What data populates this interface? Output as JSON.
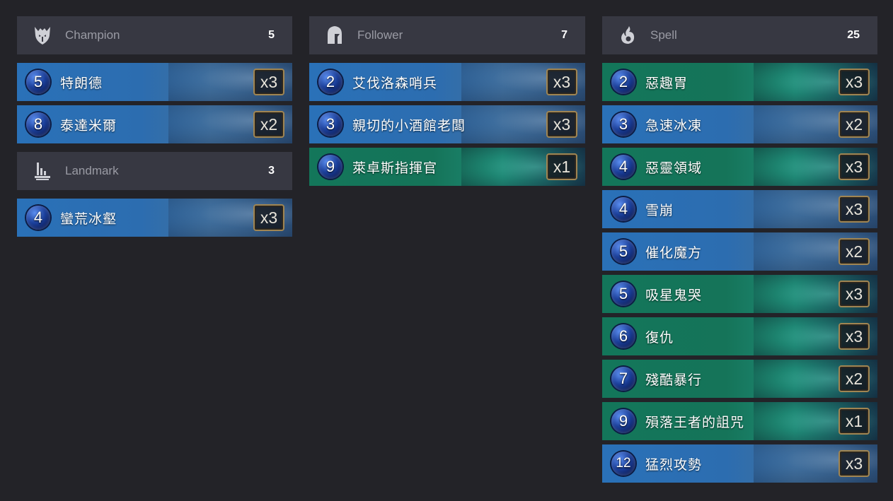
{
  "groups": [
    {
      "label": "Champion",
      "count": "5",
      "icon": "champion-helmet-icon",
      "cards": [
        {
          "cost": "5",
          "name": "特朗德",
          "copies": "x3",
          "color": "blue"
        },
        {
          "cost": "8",
          "name": "泰達米爾",
          "copies": "x2",
          "color": "blue"
        }
      ]
    },
    {
      "label": "Landmark",
      "count": "3",
      "icon": "landmark-icon",
      "cards": [
        {
          "cost": "4",
          "name": "蠻荒冰壑",
          "copies": "x3",
          "color": "blue"
        }
      ]
    },
    {
      "label": "Follower",
      "count": "7",
      "icon": "follower-helmet-icon",
      "cards": [
        {
          "cost": "2",
          "name": "艾伐洛森哨兵",
          "copies": "x3",
          "color": "blue"
        },
        {
          "cost": "3",
          "name": "親切的小酒館老闆",
          "copies": "x3",
          "color": "blue"
        },
        {
          "cost": "9",
          "name": "萊卓斯指揮官",
          "copies": "x1",
          "color": "green"
        }
      ]
    },
    {
      "label": "Spell",
      "count": "25",
      "icon": "spell-flame-icon",
      "cards": [
        {
          "cost": "2",
          "name": "惡趣胃",
          "copies": "x3",
          "color": "green"
        },
        {
          "cost": "3",
          "name": "急速冰凍",
          "copies": "x2",
          "color": "blue"
        },
        {
          "cost": "4",
          "name": "惡靈領域",
          "copies": "x3",
          "color": "green"
        },
        {
          "cost": "4",
          "name": "雪崩",
          "copies": "x3",
          "color": "blue"
        },
        {
          "cost": "5",
          "name": "催化魔方",
          "copies": "x2",
          "color": "blue"
        },
        {
          "cost": "5",
          "name": "吸星鬼哭",
          "copies": "x3",
          "color": "green"
        },
        {
          "cost": "6",
          "name": "復仇",
          "copies": "x3",
          "color": "green"
        },
        {
          "cost": "7",
          "name": "殘酷暴行",
          "copies": "x2",
          "color": "green"
        },
        {
          "cost": "9",
          "name": "殞落王者的詛咒",
          "copies": "x1",
          "color": "green"
        },
        {
          "cost": "12",
          "name": "猛烈攻勢",
          "copies": "x3",
          "color": "blue"
        }
      ]
    }
  ]
}
